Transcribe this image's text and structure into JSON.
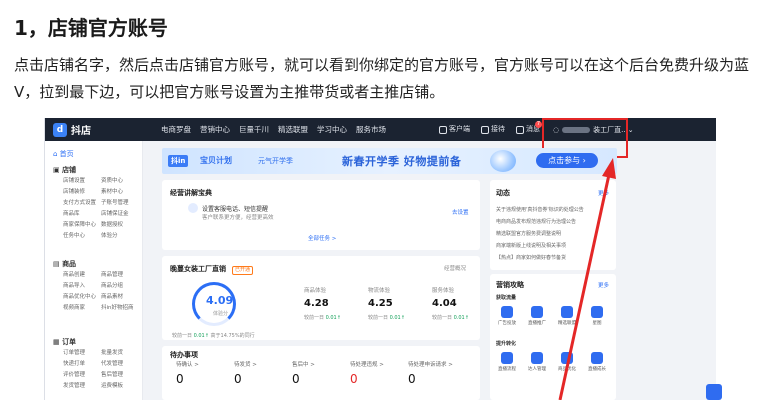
{
  "article": {
    "heading": "1，店铺官方账号",
    "paragraph": "点击店铺名字，然后点击店铺官方账号，就可以看到你绑定的官方账号，官方账号可以在这个后台免费升级为蓝V，拉到最下边，可以把官方账号设置为主推带货或者主推店铺。"
  },
  "nav": {
    "logo": "抖店",
    "logo_mark": "d",
    "menu": [
      "电商罗盘",
      "营销中心",
      "巨量千川",
      "精选联盟",
      "学习中心",
      "服务市场"
    ],
    "right": [
      "客户端",
      "接待",
      "消息"
    ],
    "badge": "7",
    "account": "装工厂直..."
  },
  "sidebar": {
    "home": "首页",
    "sections": [
      {
        "title": "店铺",
        "items": [
          "店铺设置",
          "资质中心",
          "店铺装修",
          "素材中心",
          "支付方式设置",
          "子账号管理",
          "商品库",
          "店铺保证金",
          "商家保障中心",
          "数据授权",
          "任务中心",
          "体验分"
        ]
      },
      {
        "title": "商品",
        "items": [
          "商品创建",
          "商品管理",
          "商品导入",
          "商品分组",
          "商品优化中心",
          "商品素材",
          "视频商家",
          "抖in好物招商"
        ]
      },
      {
        "title": "订单",
        "items": [
          "订单管理",
          "批量发货",
          "快递打单",
          "代发管理",
          "评价管理",
          "售后管理",
          "发货管理",
          "运费模板"
        ]
      }
    ]
  },
  "banner": {
    "tag": "抖in",
    "plan": "宝贝计划",
    "sub": "元气开学季",
    "main": "新春开学季 好物提前备",
    "button": "点击参与"
  },
  "guide": {
    "title": "经营讲解宝典",
    "line1": "设置客服电话、短信提醒",
    "line2": "客户联系更方便，经营更高效",
    "button": "去设置",
    "more": "全部任务 >"
  },
  "shop": {
    "title": "晚蔓女装工厂直销",
    "badge": "已开通",
    "link": "经营概况",
    "score": "4.09",
    "score_label": "体验分",
    "score_note_a": "较前一日",
    "score_note_a_val": "0.01",
    "score_note_b": "高于14.75%的同行",
    "metrics": [
      {
        "label": "商品体验",
        "value": "4.28",
        "note": "较前一日",
        "delta": "0.01"
      },
      {
        "label": "物流体验",
        "value": "4.25",
        "note": "较前一日",
        "delta": "0.01"
      },
      {
        "label": "服务体验",
        "value": "4.04",
        "note": "较前一日",
        "delta": "0.01"
      }
    ]
  },
  "todo": {
    "title": "待办事项",
    "columns": [
      {
        "label": "待确认 >",
        "value": "0"
      },
      {
        "label": "待发货 >",
        "value": "0"
      },
      {
        "label": "售后中 >",
        "value": "0"
      },
      {
        "label": "待处理违规 >",
        "value": "0"
      },
      {
        "label": "待处理申诉请求 >",
        "value": "0"
      }
    ]
  },
  "news": {
    "title": "动态",
    "more": "更多",
    "lines": [
      "关于违规使用'真抖音券'标识的处理公告",
      "电商商品发布规范违规行为治理公告",
      "精选联盟官方服务费调整说明",
      "商家端新版上线说明及相关事项",
      "【热点】商家如何做好春节备货"
    ]
  },
  "strategy": {
    "title": "营销攻略",
    "more": "更多",
    "sec1": "获取流量",
    "sec2": "提升转化",
    "row1": [
      "广告投放",
      "直播推广",
      "精选联盟",
      "星图"
    ],
    "row2": [
      "直播流程",
      "达人管理",
      "商品优化",
      "直播成长"
    ]
  }
}
